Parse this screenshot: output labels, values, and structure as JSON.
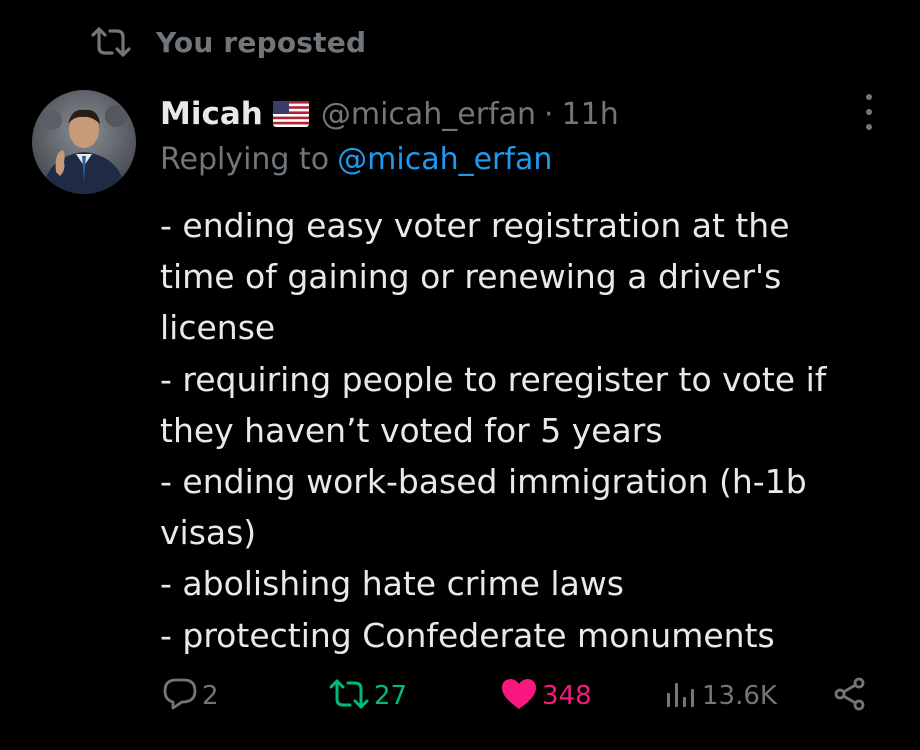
{
  "repost_header": {
    "label": "You reposted",
    "icon": "repost-icon"
  },
  "tweet": {
    "author": {
      "display_name": "Micah",
      "flag": "us-flag-icon",
      "handle": "@micah_erfan",
      "separator": "·",
      "time": "11h"
    },
    "reply_prefix": "Replying to",
    "reply_to": "@micah_erfan",
    "text_lines": [
      "- ending easy voter registration at the",
      "time of gaining or renewing a driver's",
      "license",
      "- requiring people to reregister to vote if",
      "they haven’t voted for 5 years",
      "- ending work-based immigration (h-1b",
      "visas)",
      "- abolishing hate crime laws",
      "- protecting Confederate monuments"
    ]
  },
  "actions": {
    "reply": {
      "icon": "reply-icon",
      "count": "2"
    },
    "repost": {
      "icon": "repost-icon",
      "count": "27",
      "active": true
    },
    "like": {
      "icon": "heart-icon",
      "count": "348",
      "active": true
    },
    "views": {
      "icon": "views-icon",
      "count": "13.6K"
    },
    "share": {
      "icon": "share-icon"
    }
  },
  "colors": {
    "background": "#000000",
    "text": "#e7e9ea",
    "muted": "#71767b",
    "link": "#1d9bf0",
    "repost_active": "#00ba7c",
    "like_active": "#f91880"
  }
}
